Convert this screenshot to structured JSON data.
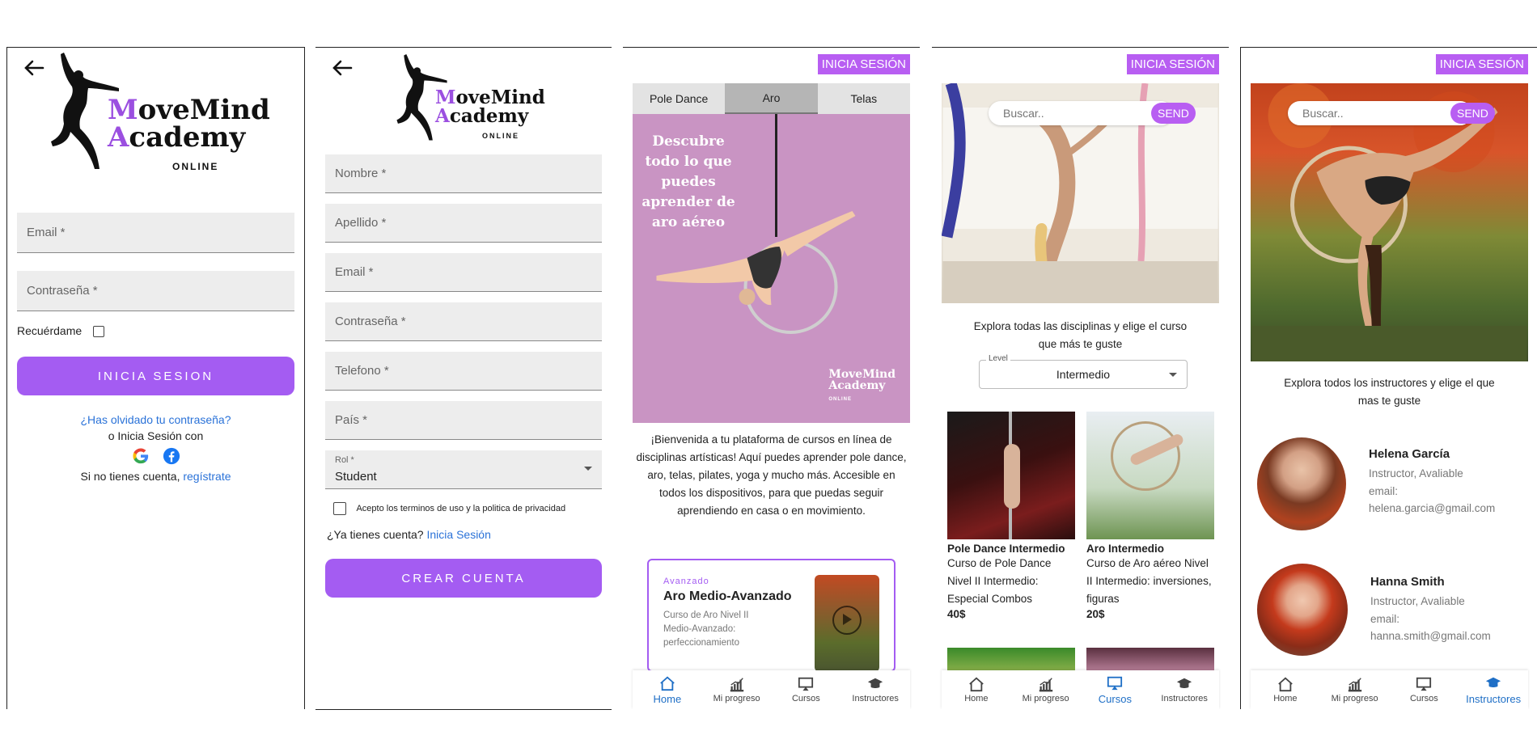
{
  "brand": {
    "name_m": "M",
    "name_rest1": "ove",
    "name_mind": "Mind",
    "name_a": "A",
    "name_rest2": "cademy",
    "online": "ONLINE",
    "accent": "#9b4fe0",
    "button_color": "#a45cf2",
    "badge_color": "#b85ef2",
    "link_color": "#2a72d8"
  },
  "login": {
    "email_placeholder": "Email *",
    "password_placeholder": "Contraseña *",
    "remember_label": "Recuérdame",
    "submit_label": "INICIA SESION",
    "forgot_link": "¿Has olvidado tu contraseña?",
    "or_social": "o Inicia Sesión con",
    "no_account_text": "Si no tienes cuenta,",
    "register_link": "regístrate"
  },
  "register": {
    "nombre": "Nombre *",
    "apellido": "Apellido *",
    "email": "Email *",
    "password": "Contraseña *",
    "telefono": "Telefono *",
    "pais": "País *",
    "rol_label": "Rol *",
    "rol_value": "Student",
    "terms": "Acepto los terminos de uso y la politica de privacidad",
    "have_account": "¿Ya tienes cuenta?",
    "login_link": "Inicia Sesión",
    "submit_label": "CREAR CUENTA"
  },
  "home": {
    "login_badge": "INICIA SESIÓN",
    "tabs": [
      "Pole Dance",
      "Aro",
      "Telas"
    ],
    "active_tab": "Aro",
    "banner_text": "Descubre todo lo que puedes aprender de aro aéreo",
    "welcome": "¡Bienvenida a tu plataforma de cursos en línea de disciplinas artísticas! Aquí puedes aprender pole dance, aro, telas, pilates, yoga y mucho más. Accesible en todos los dispositivos, para que puedas seguir aprendiendo en casa o en movimiento.",
    "card": {
      "level": "Avanzado",
      "title": "Aro Medio-Avanzado",
      "desc": "Curso de Aro Nivel II Medio-Avanzado: perfeccionamiento"
    }
  },
  "courses": {
    "login_badge": "INICIA SESIÓN",
    "search_placeholder": "Buscar..",
    "send_label": "SEND",
    "intro": "Explora todas las disciplinas y elige el curso que más te guste",
    "level_label": "Level",
    "level_value": "Intermedio",
    "items": [
      {
        "title": "Pole Dance Intermedio",
        "desc": "Curso de Pole Dance Nivel II Intermedio: Especial Combos",
        "price": "40$"
      },
      {
        "title": "Aro Intermedio",
        "desc": "Curso de Aro aéreo Nivel II Intermedio: inversiones, figuras",
        "price": "20$"
      }
    ]
  },
  "instructors": {
    "login_badge": "INICIA SESIÓN",
    "search_placeholder": "Buscar..",
    "send_label": "SEND",
    "intro": "Explora todos los instructores y elige el que mas te guste",
    "list": [
      {
        "name": "Helena García",
        "role": "Instructor, Avaliable",
        "email_label": "email:",
        "email": "helena.garcia@gmail.com"
      },
      {
        "name": "Hanna Smith",
        "role": "Instructor, Avaliable",
        "email_label": "email:",
        "email": "hanna.smith@gmail.com"
      }
    ]
  },
  "nav": {
    "items": [
      "Home",
      "Mi progreso",
      "Cursos",
      "Instructores"
    ],
    "icons": [
      "home-icon",
      "progress-chart-icon",
      "screen-icon",
      "graduation-cap-icon"
    ]
  }
}
